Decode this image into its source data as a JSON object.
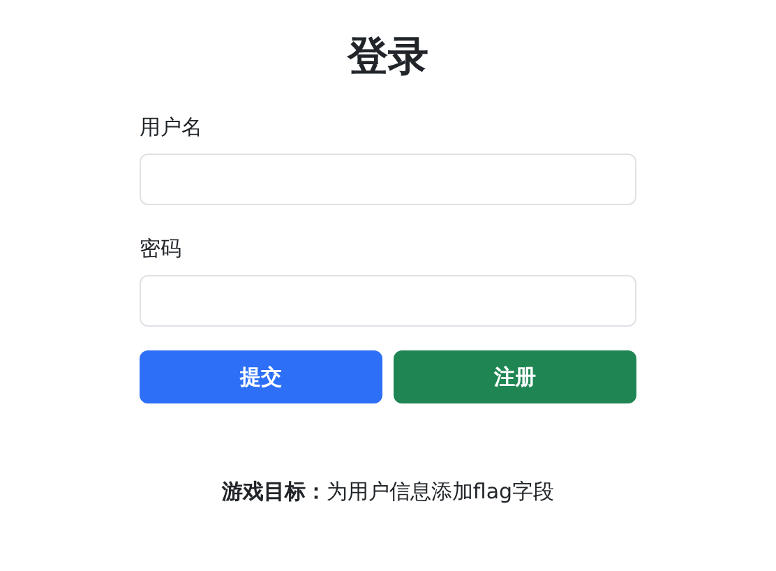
{
  "title": "登录",
  "fields": [
    {
      "label": "用户名"
    },
    {
      "label": "密码"
    }
  ],
  "buttons": [
    {
      "label": "提交",
      "kind": "primary"
    },
    {
      "label": "注册",
      "kind": "success"
    }
  ],
  "goal": "**游戏目标：**为用户信息添加flag字段"
}
